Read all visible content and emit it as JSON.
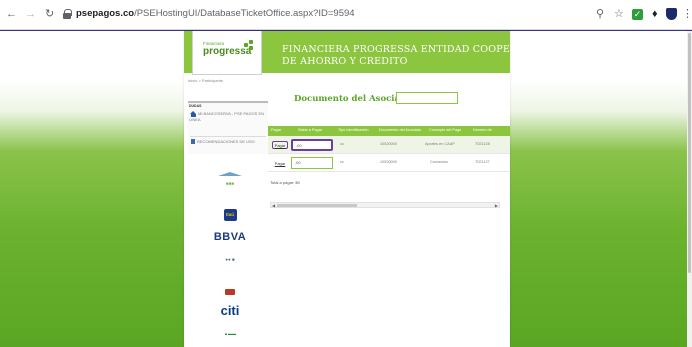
{
  "browser": {
    "url_host": "psepagos.co",
    "url_path": "/PSEHostingUI/DatabaseTicketOffice.aspx?ID=9594"
  },
  "header": {
    "logo_small": "Financiera",
    "logo_main": "progressa",
    "title_line1": "FINANCIERA PROGRESSA ENTIDAD COOPERATIA",
    "title_line2": "DE AHORRO Y CREDITO"
  },
  "breadcrumb": "Inicio > Participante",
  "sidebar": {
    "title": "DUDAS",
    "link1": "MI BANCOSERVA - PSE PAGOS EN LINEA",
    "link2": "RECOMENDACIONES DE USO"
  },
  "banks": [
    "Itaú",
    "BBVA",
    "citi"
  ],
  "main": {
    "doc_title": "Documento del Asociado",
    "doc_input_value": ""
  },
  "table": {
    "headers": [
      "Pagar",
      "Saldo a Pagar",
      "Tipo Identificación",
      "Documento del Asociado",
      "Concepto del Pago",
      "Número de"
    ],
    "rows": [
      {
        "pay": "Pagar",
        "amount": ",00",
        "type": "cc",
        "doc": "10520000",
        "concept": "Aportes en CAAP",
        "num": "T021128"
      },
      {
        "pay": "Pagar",
        "amount": ",00",
        "type": "cc",
        "doc": "10520000",
        "concept": "Convenios",
        "num": "T021127"
      }
    ],
    "total_label": "Total a pagar: $0"
  }
}
